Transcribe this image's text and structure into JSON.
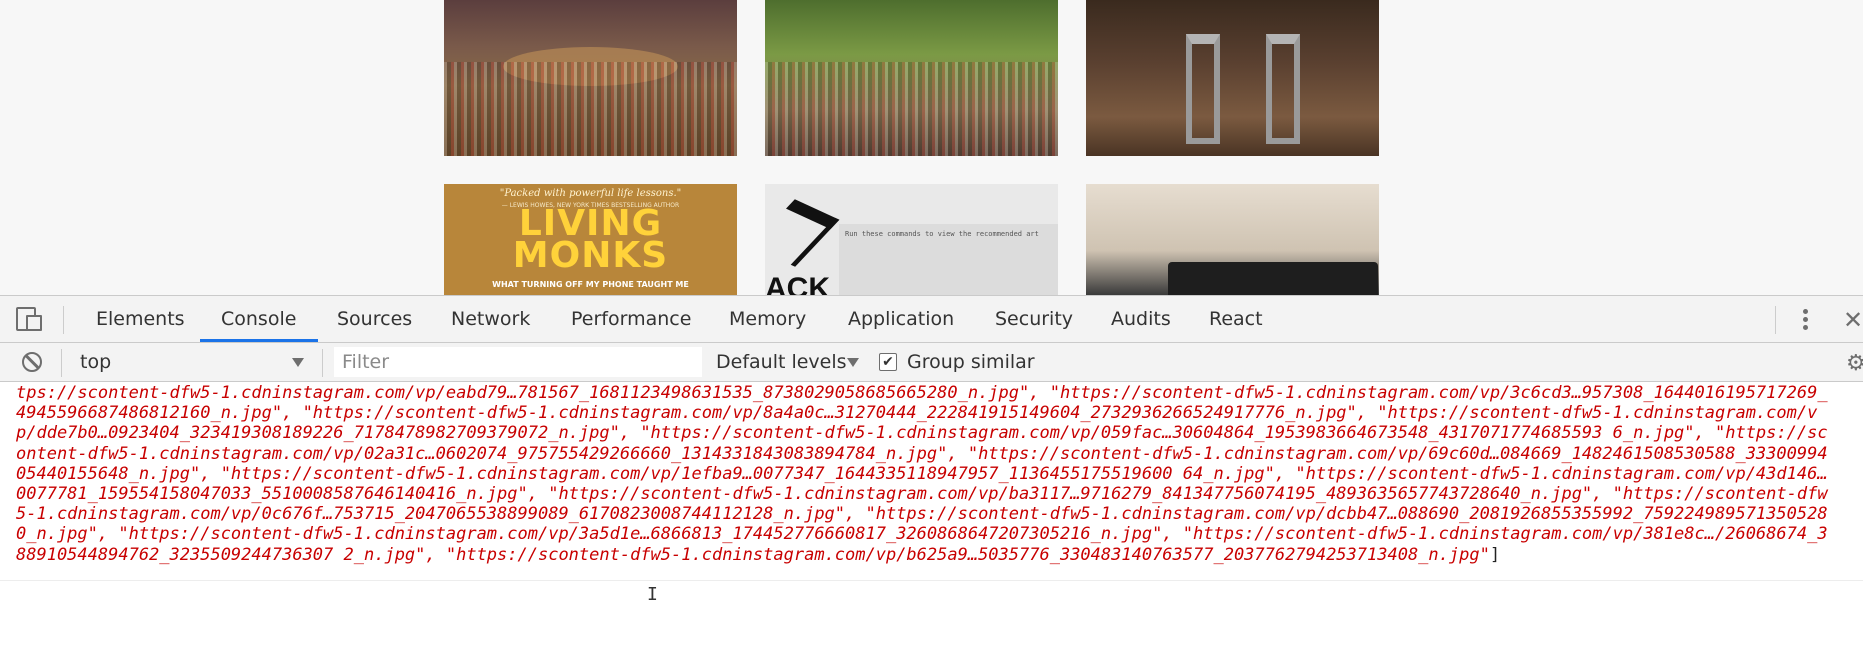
{
  "page": {
    "tiles": [
      {
        "name": "photo-baseball-stadium-1"
      },
      {
        "name": "photo-baseball-stadium-2"
      },
      {
        "name": "photo-bar-stools"
      },
      {
        "name": "photo-book-cover",
        "quote": "\"Packed with powerful life lessons.\"",
        "byline": "— LEWIS HOWES, NEW YORK TIMES BESTSELLING AUTHOR",
        "title_line1": "LIVING",
        "title_line2": "MONKS",
        "tagline": "WHAT TURNING OFF MY PHONE TAUGHT ME"
      },
      {
        "name": "photo-hack-screen",
        "logo_text": "ACK",
        "screen_text": "Run these commands to view the recommended art"
      },
      {
        "name": "photo-laptop-desk"
      }
    ]
  },
  "devtools": {
    "tabs": [
      {
        "label": "Elements"
      },
      {
        "label": "Console",
        "active": true
      },
      {
        "label": "Sources"
      },
      {
        "label": "Network"
      },
      {
        "label": "Performance"
      },
      {
        "label": "Memory"
      },
      {
        "label": "Application"
      },
      {
        "label": "Security"
      },
      {
        "label": "Audits"
      },
      {
        "label": "React"
      }
    ],
    "toolbar": {
      "context": "top",
      "filter_placeholder": "Filter",
      "levels": "Default levels",
      "group_similar_label": "Group similar",
      "group_similar_checked": true
    },
    "console_output": "tps://scontent-dfw5-1.cdninstagram.com/vp/eabd79…781567_1681123498631535_8738029058685665280_n.jpg\", \"https://scontent-dfw5-1.cdninstagram.com/vp/3c6cd3…957308_1644016195717269_4945596687486812160_n.jpg\", \"https://scontent-dfw5-1.cdninstagram.com/vp/8a4a0c…31270444_222841915149604_2732936266524917776_n.jpg\", \"https://scontent-dfw5-1.cdninstagram.com/vp/dde7b0…0923404_323419308189226_7178478982709379072_n.jpg\", \"https://scontent-dfw5-1.cdninstagram.com/vp/059fac…30604864_1953983664673548_4317071774685593 6_n.jpg\", \"https://scontent-dfw5-1.cdninstagram.com/vp/02a31c…0602074_975755429266660_1314331843083894784_n.jpg\", \"https://scontent-dfw5-1.cdninstagram.com/vp/69c60d…084669_1482461508530588_3330099405440155648_n.jpg\", \"https://scontent-dfw5-1.cdninstagram.com/vp/1efba9…0077347_1644335118947957_1136455175519600 64_n.jpg\", \"https://scontent-dfw5-1.cdninstagram.com/vp/43d146…0077781_159554158047033_5510008587646140416_n.jpg\", \"https://scontent-dfw5-1.cdninstagram.com/vp/ba3117…9716279_841347756074195_4893635657743728640_n.jpg\", \"https://scontent-dfw5-1.cdninstagram.com/vp/0c676f…753715_2047065538899089_6170823008744112128_n.jpg\", \"https://scontent-dfw5-1.cdninstagram.com/vp/dcbb47…088690_2081926855355992_7592249895713505280_n.jpg\", \"https://scontent-dfw5-1.cdninstagram.com/vp/3a5d1e…6866813_174452776660817_3260868647207305216_n.jpg\", \"https://scontent-dfw5-1.cdninstagram.com/vp/381e8c…/26068674_388910544894762_3235509244736307 2_n.jpg\", \"https://scontent-dfw5-1.cdninstagram.com/vp/b625a9…5035776_330483140763577_2037762794253713408_n.jpg\"",
    "console_close_bracket": "]",
    "colors": {
      "accent": "#1a73e8",
      "log_string": "#c80000",
      "panel_bg": "#f3f3f3"
    }
  }
}
